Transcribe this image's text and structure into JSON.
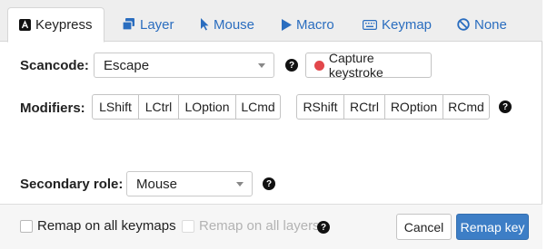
{
  "tabs": [
    {
      "label": "Keypress",
      "icon": "keypress-icon",
      "active": true
    },
    {
      "label": "Layer",
      "icon": "layer-icon"
    },
    {
      "label": "Mouse",
      "icon": "mouse-pointer-icon"
    },
    {
      "label": "Macro",
      "icon": "play-icon"
    },
    {
      "label": "Keymap",
      "icon": "keyboard-icon"
    },
    {
      "label": "None",
      "icon": "none-icon"
    }
  ],
  "scancode": {
    "label": "Scancode:",
    "value": "Escape",
    "help": "?",
    "capture_label": "Capture keystroke"
  },
  "modifiers": {
    "label": "Modifiers:",
    "left": [
      "LShift",
      "LCtrl",
      "LOption",
      "LCmd"
    ],
    "right": [
      "RShift",
      "RCtrl",
      "ROption",
      "RCmd"
    ],
    "help": "?"
  },
  "secondary": {
    "label": "Secondary role:",
    "value": "Mouse",
    "help": "?"
  },
  "footer": {
    "remap_all_keymaps": "Remap on all keymaps",
    "remap_all_layers": "Remap on all layers",
    "help": "?",
    "cancel": "Cancel",
    "remap_key": "Remap key"
  },
  "colors": {
    "accent": "#3d7ec6",
    "tab_link": "#2a6dbf",
    "record_dot": "#e2474b"
  }
}
